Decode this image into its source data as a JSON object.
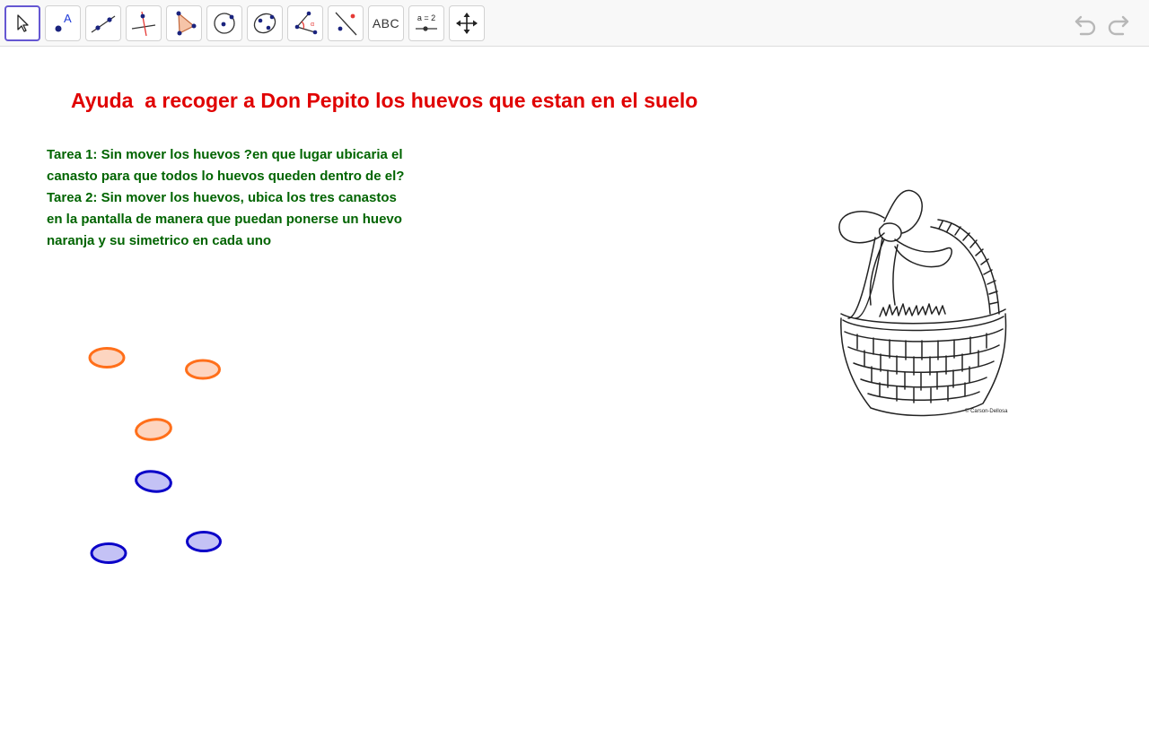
{
  "toolbar": {
    "tools": [
      {
        "name": "move-tool",
        "icon": "cursor-arrow-icon",
        "selected": true
      },
      {
        "name": "point-tool",
        "icon": "point-icon",
        "label": "A"
      },
      {
        "name": "line-tool",
        "icon": "line-through-points-icon"
      },
      {
        "name": "perpendicular-line-tool",
        "icon": "perpendicular-line-icon"
      },
      {
        "name": "polygon-tool",
        "icon": "polygon-icon"
      },
      {
        "name": "circle-tool",
        "icon": "circle-center-point-icon"
      },
      {
        "name": "conic-tool",
        "icon": "ellipse-icon"
      },
      {
        "name": "angle-tool",
        "icon": "angle-icon",
        "label": "α"
      },
      {
        "name": "reflect-tool",
        "icon": "reflect-about-line-icon"
      },
      {
        "name": "text-tool",
        "icon": "text-icon",
        "label": "ABC"
      },
      {
        "name": "slider-tool",
        "icon": "slider-icon",
        "label": "a = 2"
      },
      {
        "name": "move-graphics-view-tool",
        "icon": "move-arrows-icon"
      }
    ],
    "undo_icon": "undo-icon",
    "redo_icon": "redo-icon"
  },
  "title": "Ayuda  a recoger a Don Pepito los huevos que estan en el suelo",
  "task": {
    "line1": "Tarea 1: Sin mover los huevos ?en que lugar ubicaria el",
    "line2": "canasto para que todos lo huevos queden dentro de el?",
    "line3": "Tarea 2: Sin mover los huevos, ubica los tres canastos",
    "line4": "en la pantalla de manera que puedan ponerse un huevo",
    "line5": "naranja y su simetrico en cada uno"
  },
  "eggs": {
    "orange_count": 3,
    "blue_count": 3,
    "orange_stroke": "#ff6f1a",
    "orange_fill": "#fdd5c0",
    "blue_stroke": "#0a00c8",
    "blue_fill": "#c4c2f5"
  },
  "basket": {
    "copyright": "© Carson-Dellosa"
  },
  "colors": {
    "title": "#e00000",
    "task": "#006400",
    "tool_selected_border": "#6557d2"
  }
}
